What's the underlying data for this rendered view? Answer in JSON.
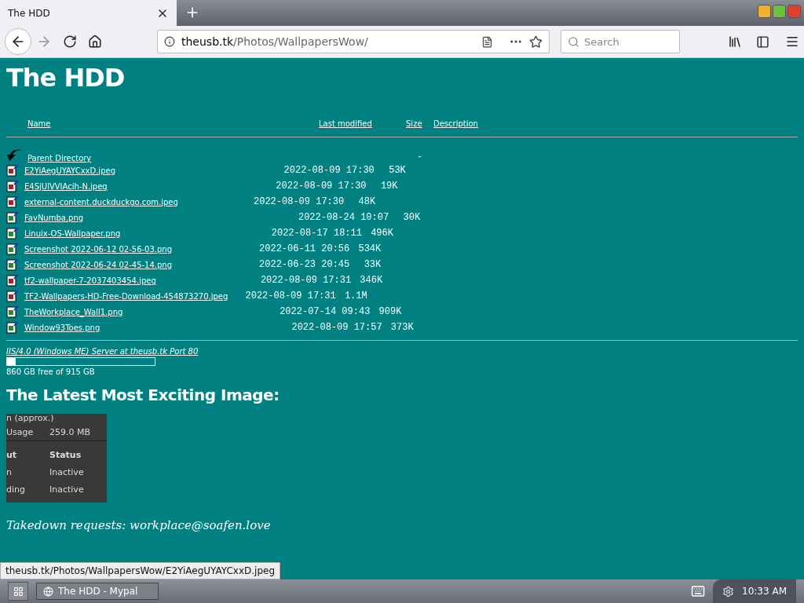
{
  "browser": {
    "tab": {
      "title": "The HDD",
      "selected": true
    },
    "url_host": "theusb.tk",
    "url_path": "/Photos/WallpapersWow/",
    "search": {
      "placeholder": "Search"
    }
  },
  "page": {
    "title": "The HDD",
    "columns": [
      "Name",
      "Last modified",
      "Size",
      "Description"
    ],
    "parent": {
      "name": "Parent Directory",
      "size": "-"
    },
    "files": [
      {
        "name": "E2YiAegUYAYCxxD.jpeg",
        "kind": "jpeg",
        "modified": "2022-08-09 17:30",
        "size": "53K"
      },
      {
        "name": "E4SjUlVVIAcih-N.jpeg",
        "kind": "jpeg",
        "modified": "2022-08-09 17:30",
        "size": "19K"
      },
      {
        "name": "external-content.duckduckgo.com.jpeg",
        "kind": "jpeg",
        "modified": "2022-08-09 17:30",
        "size": "48K"
      },
      {
        "name": "FavNumba.png",
        "kind": "png",
        "modified": "2022-08-24 10:07",
        "size": "30K"
      },
      {
        "name": "Linuix-OS-Wallpaper.png",
        "kind": "png",
        "modified": "2022-08-17 18:11",
        "size": "496K"
      },
      {
        "name": "Screenshot 2022-06-12 02-56-03.png",
        "kind": "png",
        "modified": "2022-06-11 20:56",
        "size": "534K"
      },
      {
        "name": "Screenshot 2022-06-24 02-45-14.png",
        "kind": "png",
        "modified": "2022-06-23 20:45",
        "size": "33K"
      },
      {
        "name": "tf2-wallpaper-7-2037403454.jpeg",
        "kind": "jpeg",
        "modified": "2022-08-09 17:31",
        "size": "346K"
      },
      {
        "name": "TF2-Wallpapers-HD-Free-Download-454873270.jpeg",
        "kind": "jpeg",
        "modified": "2022-08-09 17:31",
        "size": "1.1M"
      },
      {
        "name": "TheWorkplace_Wall1.png",
        "kind": "png",
        "modified": "2022-07-14 09:43",
        "size": "909K"
      },
      {
        "name": "Window93Toes.png",
        "kind": "png",
        "modified": "2022-08-09 17:57",
        "size": "373K"
      }
    ],
    "server": "IIS/4.0 (Windows ME) Server at theusb.tk Port 80",
    "disk": {
      "level": 0.06,
      "text": "860 GB free of 915 GB"
    },
    "latest_heading": "The Latest Most Exciting Image:",
    "latest_image": {
      "top": "n (approx.)",
      "usage_label": "Usage",
      "usage_value": "259.0 MB",
      "col_1": "ut",
      "col_2": "Status",
      "rows": [
        [
          "n",
          "Inactive"
        ],
        [
          "ding",
          "Inactive"
        ]
      ]
    },
    "takedown": "Takedown requests: workplace@soafen.love"
  },
  "status_url": "theusb.tk/Photos/WallpapersWow/E2YiAegUYAYCxxD.jpeg",
  "taskbar": {
    "task": "The HDD - Mypal",
    "clock": "10:33 AM"
  }
}
